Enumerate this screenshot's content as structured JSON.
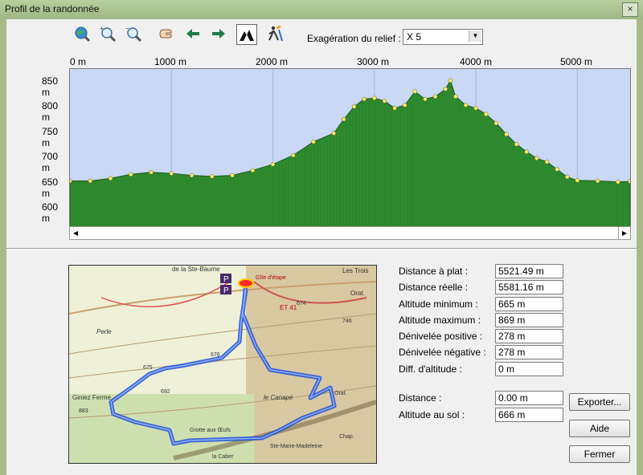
{
  "window": {
    "title": "Profil de la randonnée",
    "close_glyph": "×"
  },
  "toolbar": {
    "icons": [
      "globe-zoom-icon",
      "zoom-in-icon",
      "zoom-out-icon",
      "pan-hand-icon",
      "arrow-left-icon",
      "arrow-right-icon",
      "terrain-profile-icon",
      "hiker-icon"
    ],
    "exaggeration_label": "Exagération du relief :",
    "exaggeration_value": "X 5"
  },
  "chart_data": {
    "type": "area",
    "x_ticks": [
      "0 m",
      "1000 m",
      "2000 m",
      "3000 m",
      "4000 m",
      "5000 m"
    ],
    "y_ticks": [
      "850 m",
      "800 m",
      "750 m",
      "700 m",
      "650 m",
      "600 m"
    ],
    "xlim": [
      0,
      5520
    ],
    "ylim": [
      575,
      890
    ],
    "x": [
      0,
      200,
      400,
      600,
      800,
      1000,
      1200,
      1400,
      1600,
      1800,
      2000,
      2200,
      2400,
      2600,
      2700,
      2800,
      2900,
      3000,
      3100,
      3200,
      3300,
      3400,
      3500,
      3600,
      3700,
      3750,
      3800,
      3900,
      4000,
      4100,
      4200,
      4300,
      4400,
      4500,
      4600,
      4700,
      4800,
      4900,
      5000,
      5200,
      5400,
      5520
    ],
    "y": [
      667,
      667,
      672,
      680,
      684,
      682,
      678,
      676,
      678,
      688,
      700,
      718,
      745,
      762,
      790,
      815,
      830,
      832,
      826,
      812,
      818,
      845,
      830,
      835,
      850,
      867,
      835,
      818,
      812,
      800,
      782,
      760,
      740,
      725,
      712,
      705,
      690,
      675,
      668,
      667,
      665,
      666
    ],
    "fill": "#2e8b2e",
    "background": "#c8d8f5"
  },
  "stats": {
    "distance_plat": {
      "label": "Distance à plat :",
      "value": "5521.49 m"
    },
    "distance_reelle": {
      "label": "Distance réelle :",
      "value": "5581.16 m"
    },
    "altitude_min": {
      "label": "Altitude minimum :",
      "value": "665 m"
    },
    "altitude_max": {
      "label": "Altitude maximum :",
      "value": "869 m"
    },
    "deniv_pos": {
      "label": "Dénivelée positive :",
      "value": "278 m"
    },
    "deniv_neg": {
      "label": "Dénivelée négative :",
      "value": "278 m"
    },
    "diff_alt": {
      "label": "Diff. d'altitude :",
      "value": "0 m"
    },
    "distance": {
      "label": "Distance :",
      "value": "0.00 m"
    },
    "altitude_sol": {
      "label": "Altitude au sol :",
      "value": "666 m"
    }
  },
  "buttons": {
    "export": "Exporter...",
    "help": "Aide",
    "close": "Fermer"
  },
  "map": {
    "labels": [
      "de la Ste-Baume",
      "Gîte d'étape",
      "Les Trois",
      "Orat.",
      "ET 41",
      "Giniez Ferme",
      "le Canapé",
      "Grotte aux Œufs",
      "Ste-Marie-Madeleine",
      "Orat.",
      "Chap.",
      "la Caber",
      "Perle",
      "674",
      "676",
      "675",
      "692",
      "746",
      "883"
    ]
  }
}
